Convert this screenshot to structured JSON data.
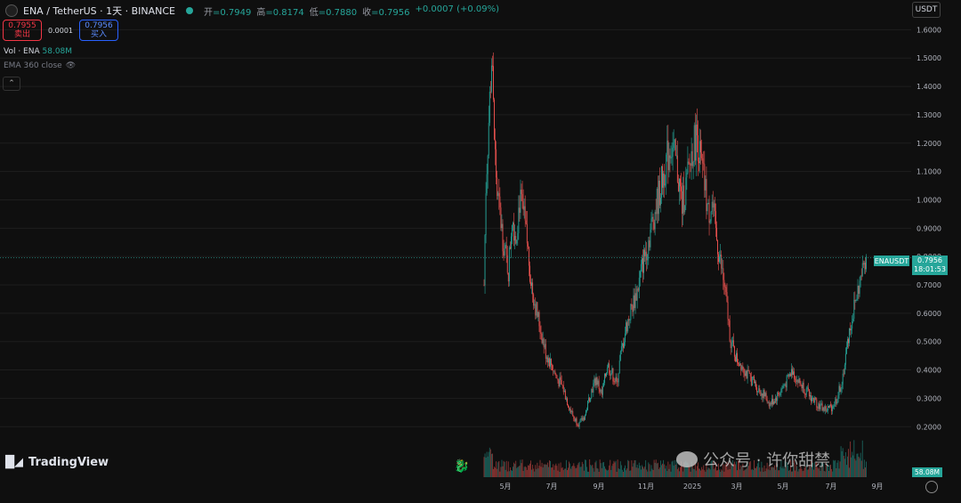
{
  "header": {
    "symbol": "ENA / TetherUS · 1天 · BINANCE",
    "ohlc": [
      {
        "label": "开",
        "value": "=0.7949"
      },
      {
        "label": "高",
        "value": "=0.8174"
      },
      {
        "label": "低",
        "value": "=0.7880"
      },
      {
        "label": "收",
        "value": "=0.7956"
      },
      {
        "label": "",
        "value": "+0.0007 (+0.09%)"
      }
    ]
  },
  "trade": {
    "sell_price": "0.7955",
    "sell_label": "卖出",
    "spread": "0.0001",
    "buy_price": "0.7956",
    "buy_label": "买入"
  },
  "volume_legend": {
    "label": "Vol · ENA",
    "value": "58.08M"
  },
  "ema_legend": {
    "label": "EMA 360 close"
  },
  "currency": "USDT",
  "brand": "TradingView",
  "watermark": "公众号 · 许你甜禁",
  "labels": {
    "symbol_tag": "ENAUSDT",
    "last_price": "0.7956",
    "countdown": "18:01:53",
    "volume": "58.08M"
  },
  "colors": {
    "up": "#26a69a",
    "down": "#ef5350",
    "background": "#0f0f0f",
    "grid": "#1e1e1e"
  },
  "chart_data": {
    "type": "candlestick",
    "y_ticks": [
      "1.6000",
      "1.5000",
      "1.4000",
      "1.3000",
      "1.2000",
      "1.1000",
      "1.0000",
      "0.9000",
      "0.8000",
      "0.7000",
      "0.6000",
      "0.5000",
      "0.4000",
      "0.3000",
      "0.2000"
    ],
    "x_ticks": [
      "5月",
      "7月",
      "9月",
      "11月",
      "2025",
      "3月",
      "5月",
      "7月",
      "9月"
    ],
    "ylim": [
      0.16,
      1.62
    ],
    "price_path": [
      [
        0,
        0.7
      ],
      [
        2,
        1.05
      ],
      [
        5,
        1.28
      ],
      [
        8,
        1.5
      ],
      [
        11,
        1.22
      ],
      [
        14,
        1.02
      ],
      [
        18,
        0.92
      ],
      [
        22,
        0.82
      ],
      [
        26,
        0.75
      ],
      [
        30,
        0.95
      ],
      [
        34,
        0.87
      ],
      [
        38,
        1.0
      ],
      [
        42,
        0.95
      ],
      [
        46,
        0.85
      ],
      [
        50,
        0.72
      ],
      [
        54,
        0.64
      ],
      [
        60,
        0.55
      ],
      [
        66,
        0.46
      ],
      [
        72,
        0.42
      ],
      [
        78,
        0.37
      ],
      [
        84,
        0.34
      ],
      [
        90,
        0.28
      ],
      [
        96,
        0.23
      ],
      [
        102,
        0.21
      ],
      [
        108,
        0.24
      ],
      [
        114,
        0.32
      ],
      [
        120,
        0.37
      ],
      [
        126,
        0.31
      ],
      [
        132,
        0.42
      ],
      [
        138,
        0.38
      ],
      [
        142,
        0.35
      ],
      [
        146,
        0.45
      ],
      [
        152,
        0.55
      ],
      [
        158,
        0.62
      ],
      [
        164,
        0.68
      ],
      [
        170,
        0.78
      ],
      [
        176,
        0.86
      ],
      [
        182,
        0.95
      ],
      [
        188,
        1.03
      ],
      [
        194,
        1.12
      ],
      [
        200,
        1.2
      ],
      [
        206,
        1.12
      ],
      [
        212,
        0.98
      ],
      [
        218,
        1.08
      ],
      [
        223,
        1.18
      ],
      [
        228,
        1.23
      ],
      [
        232,
        1.13
      ],
      [
        236,
        1.05
      ],
      [
        240,
        0.95
      ],
      [
        244,
        0.99
      ],
      [
        248,
        0.88
      ],
      [
        252,
        0.8
      ],
      [
        256,
        0.72
      ],
      [
        260,
        0.62
      ],
      [
        264,
        0.5
      ],
      [
        270,
        0.44
      ],
      [
        276,
        0.42
      ],
      [
        282,
        0.38
      ],
      [
        288,
        0.36
      ],
      [
        294,
        0.33
      ],
      [
        300,
        0.31
      ],
      [
        306,
        0.28
      ],
      [
        312,
        0.3
      ],
      [
        318,
        0.33
      ],
      [
        324,
        0.36
      ],
      [
        330,
        0.4
      ],
      [
        336,
        0.36
      ],
      [
        342,
        0.34
      ],
      [
        348,
        0.31
      ],
      [
        354,
        0.29
      ],
      [
        360,
        0.27
      ],
      [
        366,
        0.26
      ],
      [
        372,
        0.27
      ],
      [
        378,
        0.3
      ],
      [
        384,
        0.38
      ],
      [
        390,
        0.52
      ],
      [
        396,
        0.62
      ],
      [
        400,
        0.68
      ],
      [
        404,
        0.73
      ],
      [
        408,
        0.8
      ]
    ]
  }
}
